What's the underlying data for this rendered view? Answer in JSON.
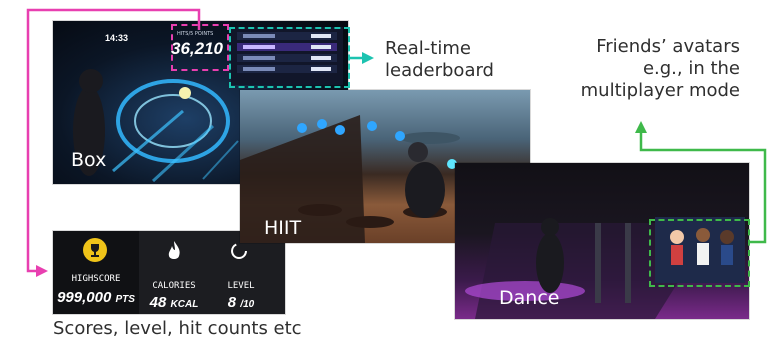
{
  "labels": {
    "leaderboard": [
      "Real-time",
      "leaderboard"
    ],
    "friends": [
      "Friends’ avatars",
      "e.g., in the",
      "multiplayer mode"
    ],
    "scores": "Scores, level, hit counts etc"
  },
  "screens": {
    "box": {
      "label": "Box",
      "score_caption": "HITS/5 POINTS",
      "score_value": "36,210",
      "timer": "14:33"
    },
    "hiit": {
      "label": "HIIT"
    },
    "dance": {
      "label": "Dance"
    }
  },
  "stats_panel": {
    "items": [
      {
        "icon": "trophy-icon",
        "caption": "HIGHSCORE",
        "value": "999,000",
        "unit": "PTS"
      },
      {
        "icon": "flame-icon",
        "caption": "CALORIES",
        "value": "48",
        "unit": "KCAL"
      },
      {
        "icon": "level-ring-icon",
        "caption": "LEVEL",
        "value": "8",
        "unit": "/10"
      }
    ]
  },
  "colors": {
    "pink": "#e83fb0",
    "teal": "#1cc3b0",
    "green": "#3fb94a",
    "label_text": "#2f2f2f",
    "trophy": "#f0c419"
  }
}
